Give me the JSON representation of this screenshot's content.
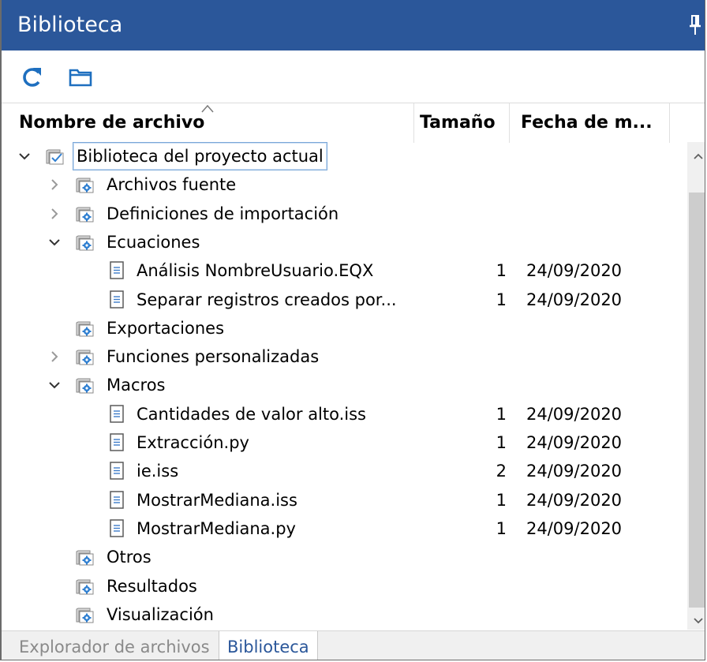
{
  "panel": {
    "title": "Biblioteca",
    "pin_icon": "pin-icon"
  },
  "toolbar": {
    "refresh_icon": "refresh-icon",
    "folder_icon": "folder-icon"
  },
  "columns": {
    "name": "Nombre de archivo",
    "size": "Tamaño",
    "date": "Fecha de m..."
  },
  "tree": [
    {
      "label": "Biblioteca del proyecto actual",
      "type": "root",
      "expanded": true,
      "size": "",
      "date": ""
    },
    {
      "label": "Archivos fuente",
      "type": "folder",
      "expanded": false,
      "size": "",
      "date": ""
    },
    {
      "label": "Definiciones de importación",
      "type": "folder",
      "expanded": false,
      "size": "",
      "date": ""
    },
    {
      "label": "Ecuaciones",
      "type": "folder",
      "expanded": true,
      "size": "",
      "date": ""
    },
    {
      "label": "Análisis NombreUsuario.EQX",
      "type": "file",
      "size": "1",
      "date": "24/09/2020"
    },
    {
      "label": "Separar registros creados por...",
      "type": "file",
      "size": "1",
      "date": "24/09/2020"
    },
    {
      "label": "Exportaciones",
      "type": "folder",
      "size": "",
      "date": ""
    },
    {
      "label": "Funciones personalizadas",
      "type": "folder",
      "expanded": false,
      "size": "",
      "date": ""
    },
    {
      "label": "Macros",
      "type": "folder",
      "expanded": true,
      "size": "",
      "date": ""
    },
    {
      "label": "Cantidades de valor alto.iss",
      "type": "file",
      "size": "1",
      "date": "24/09/2020"
    },
    {
      "label": "Extracción.py",
      "type": "file",
      "size": "1",
      "date": "24/09/2020"
    },
    {
      "label": "ie.iss",
      "type": "file",
      "size": "2",
      "date": "24/09/2020"
    },
    {
      "label": "MostrarMediana.iss",
      "type": "file",
      "size": "1",
      "date": "24/09/2020"
    },
    {
      "label": "MostrarMediana.py",
      "type": "file",
      "size": "1",
      "date": "24/09/2020"
    },
    {
      "label": "Otros",
      "type": "folder",
      "size": "",
      "date": ""
    },
    {
      "label": "Resultados",
      "type": "folder",
      "size": "",
      "date": ""
    },
    {
      "label": "Visualización",
      "type": "folder",
      "size": "",
      "date": ""
    }
  ],
  "tabs": [
    {
      "label": "Explorador de archivos",
      "active": false
    },
    {
      "label": "Biblioteca",
      "active": true
    }
  ],
  "colors": {
    "title_bar": "#2b579a",
    "accent": "#2b579a"
  }
}
